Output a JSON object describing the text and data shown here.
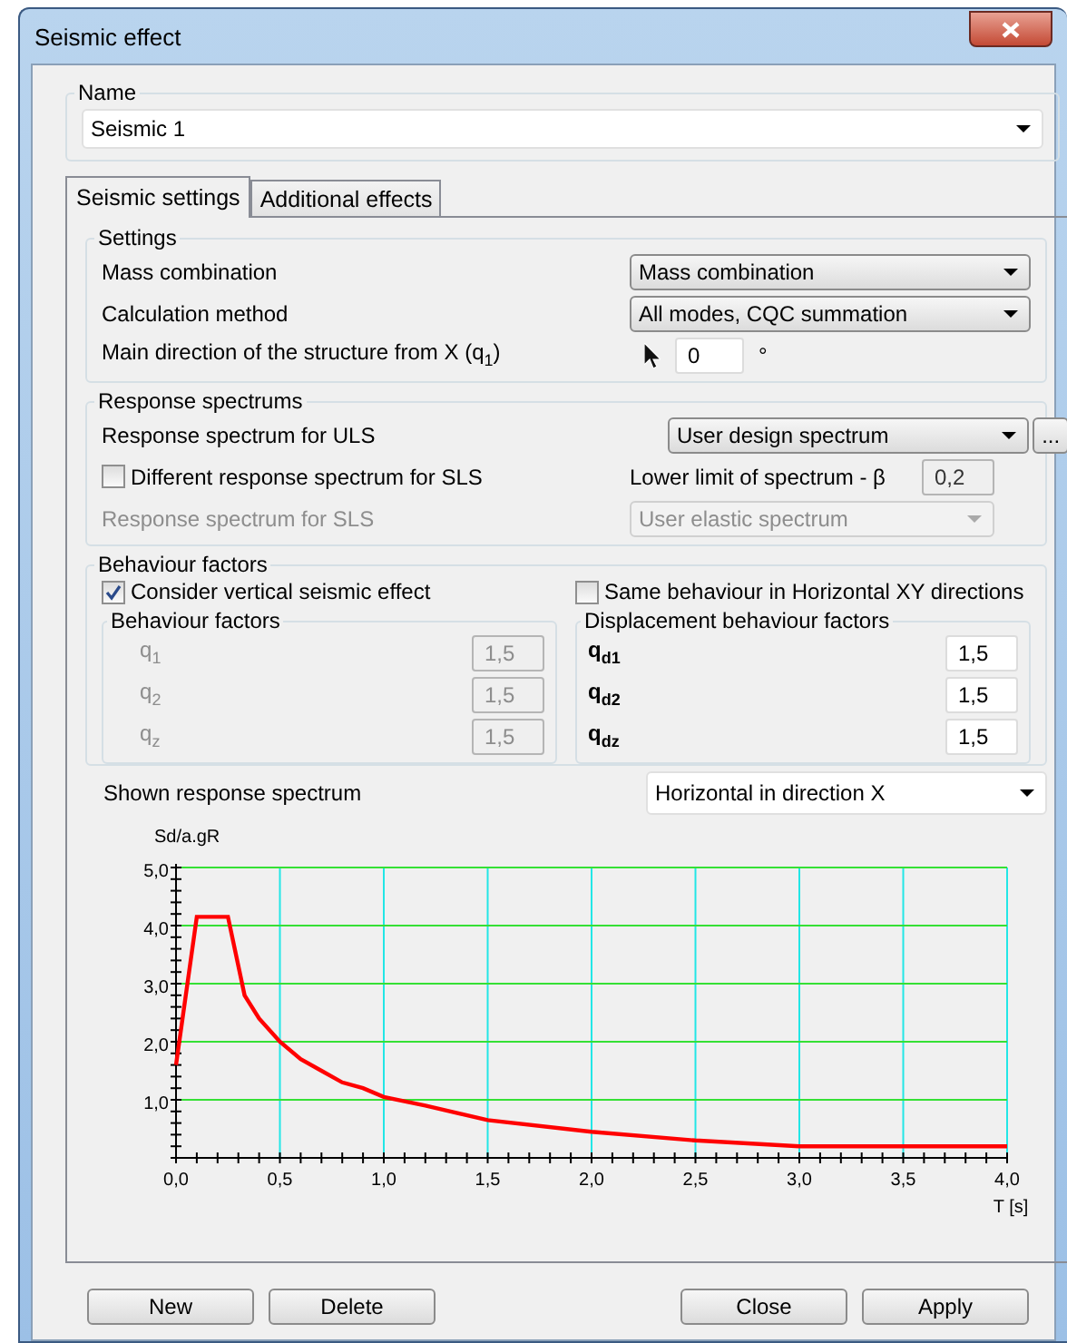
{
  "window": {
    "title": "Seismic effect"
  },
  "name_group": {
    "title": "Name",
    "value": "Seismic 1"
  },
  "tabs": [
    {
      "label": "Seismic settings",
      "selected": true
    },
    {
      "label": "Additional effects",
      "selected": false
    }
  ],
  "settings": {
    "title": "Settings",
    "rows": [
      {
        "kind": "dropdown",
        "label": "Mass combination",
        "value": "Mass combination"
      },
      {
        "kind": "dropdown",
        "label": "Calculation method",
        "value": "All modes, CQC summation"
      },
      {
        "kind": "number",
        "label": "Main direction of the structure from X (q$_{1}$)",
        "value": "0",
        "unit": "°"
      }
    ]
  },
  "response_spectrums": {
    "title": "Response spectrums",
    "uls": {
      "label": "Response spectrum for ULS",
      "value": "User design spectrum",
      "more": "..."
    },
    "different_sls": {
      "label": "Different response spectrum for SLS",
      "checked": false
    },
    "lower_limit": {
      "label": "Lower limit of spectrum - β",
      "value": "0,2"
    },
    "sls": {
      "label": "Response spectrum for SLS",
      "value": "User elastic spectrum",
      "disabled": true
    }
  },
  "behaviour": {
    "title": "Behaviour factors",
    "checks": [
      {
        "label": "Consider vertical seismic effect",
        "checked": true
      },
      {
        "label": "Same behaviour in Horizontal XY directions",
        "checked": false
      }
    ],
    "groups": [
      {
        "title": "Behaviour factors",
        "disabled": true,
        "bold": false,
        "items": [
          {
            "symbol": "q$_{1}$",
            "value": "1,5"
          },
          {
            "symbol": "q$_{2}$",
            "value": "1,5"
          },
          {
            "symbol": "q$_{z}$",
            "value": "1,5"
          }
        ]
      },
      {
        "title": "Displacement behaviour factors",
        "disabled": false,
        "bold": true,
        "items": [
          {
            "symbol": "q$_{d1}$",
            "value": "1,5"
          },
          {
            "symbol": "q$_{d2}$",
            "value": "1,5"
          },
          {
            "symbol": "q$_{dz}$",
            "value": "1,5"
          }
        ]
      }
    ]
  },
  "shown_spectrum": {
    "label": "Shown response spectrum",
    "value": "Horizontal in direction X",
    "chart_data": {
      "type": "line",
      "grid": true,
      "ylabel": "Sd/a.gR",
      "xlabel": "T [s]",
      "x": [
        0,
        0.1,
        0.25,
        0.33,
        0.4,
        0.5,
        0.6,
        0.7,
        0.8,
        0.9,
        1.0,
        1.2,
        1.5,
        2.0,
        2.5,
        3.0,
        3.5,
        4.0
      ],
      "series": [
        {
          "color": "#ff0000",
          "values": [
            1.6,
            4.15,
            4.15,
            2.8,
            2.4,
            2.0,
            1.7,
            1.5,
            1.3,
            1.2,
            1.05,
            0.9,
            0.65,
            0.45,
            0.3,
            0.2,
            0.2,
            0.2
          ]
        }
      ],
      "xlim": [
        0,
        4
      ],
      "ylim": [
        0,
        5
      ],
      "xticks": [
        {
          "value": 0,
          "label": "0,0"
        },
        {
          "value": 0.5,
          "label": "0,5"
        },
        {
          "value": 1,
          "label": "1,0"
        },
        {
          "value": 1.5,
          "label": "1,5"
        },
        {
          "value": 2,
          "label": "2,0"
        },
        {
          "value": 2.5,
          "label": "2,5"
        },
        {
          "value": 3,
          "label": "3,0"
        },
        {
          "value": 3.5,
          "label": "3,5"
        },
        {
          "value": 4,
          "label": "4,0"
        }
      ],
      "yticks": [
        {
          "value": 1,
          "label": "1,0"
        },
        {
          "value": 2,
          "label": "2,0"
        },
        {
          "value": 3,
          "label": "3,0"
        },
        {
          "value": 4,
          "label": "4,0"
        },
        {
          "value": 5,
          "label": "5,0"
        }
      ]
    }
  },
  "button_groups": [
    [
      "New",
      "Delete"
    ],
    [
      "Close",
      "Apply"
    ]
  ]
}
